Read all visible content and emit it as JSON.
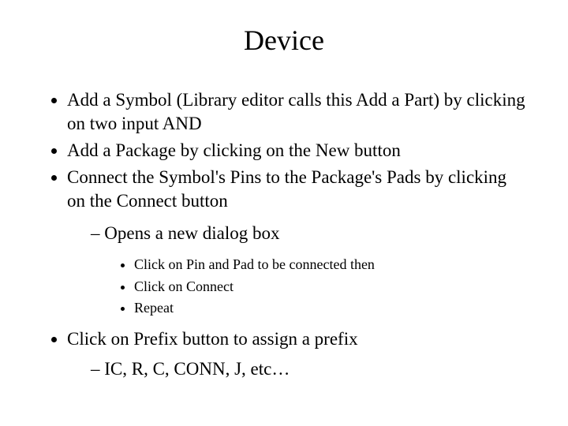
{
  "title": "Device",
  "bullets": {
    "b1": "Add a Symbol (Library editor calls this Add a Part) by clicking on two input AND",
    "b2": "Add a Package by clicking on the New button",
    "b3": "Connect the Symbol's Pins to the Package's Pads by clicking on the Connect button",
    "b3_sub1": "Opens a new dialog box",
    "b3_sub1_a": "Click on Pin and Pad to be connected then",
    "b3_sub1_b": "Click on Connect",
    "b3_sub1_c": "Repeat",
    "b4": "Click on Prefix button to assign a prefix",
    "b4_sub1": "IC, R, C, CONN, J, etc…"
  }
}
